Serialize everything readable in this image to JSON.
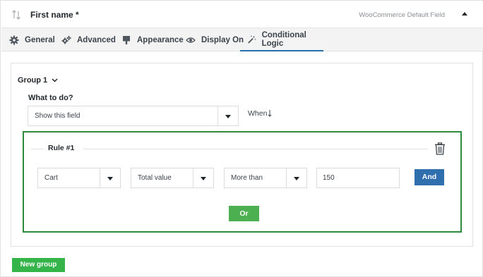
{
  "header": {
    "field_title": "First name *",
    "field_type": "WooCommerce Default Field"
  },
  "tabs": [
    {
      "label": "General",
      "icon": "gear-icon"
    },
    {
      "label": "Advanced",
      "icon": "gears-icon"
    },
    {
      "label": "Appearance",
      "icon": "paint-brush-icon"
    },
    {
      "label": "Display On",
      "icon": "eye-icon"
    },
    {
      "label": "Conditional Logic",
      "icon": "magic-wand-icon",
      "active": true
    }
  ],
  "group": {
    "label": "Group 1",
    "what_to_do_label": "What to do?",
    "action_value": "Show this field",
    "when_label": "When"
  },
  "rule": {
    "title": "Rule #1",
    "type_value": "Cart",
    "property_value": "Total value",
    "operator_value": "More than",
    "compare_value": "150",
    "and_label": "And",
    "or_label": "Or"
  },
  "new_group_label": "New group",
  "colors": {
    "rule_border": "#2e8b3e",
    "and_button": "#2f6fad",
    "or_button": "#4caf50",
    "new_group_button": "#35b44a",
    "active_tab_underline": "#2271b1"
  }
}
